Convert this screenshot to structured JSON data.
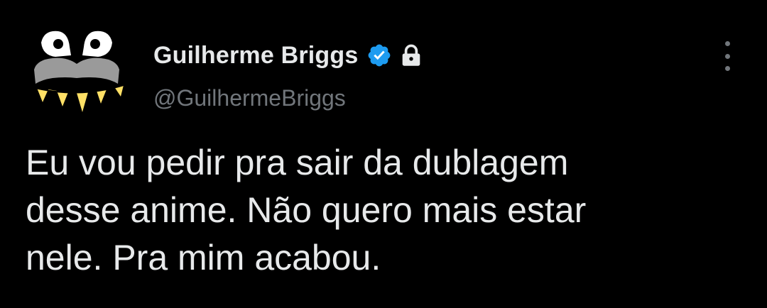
{
  "author": {
    "display_name": "Guilherme Briggs",
    "handle": "@GuilhermeBriggs",
    "verified": true,
    "protected": true,
    "avatar_icon": "mustache-face-icon"
  },
  "menu": {
    "icon": "more-options-icon"
  },
  "tweet": {
    "text": "Eu vou pedir pra sair da dublagem\ndesse anime. Não quero mais estar\nnele. Pra mim acabou."
  },
  "colors": {
    "background": "#000000",
    "text_primary": "#e7e9ea",
    "text_secondary": "#71767b",
    "verified_blue": "#1d9bf0"
  }
}
